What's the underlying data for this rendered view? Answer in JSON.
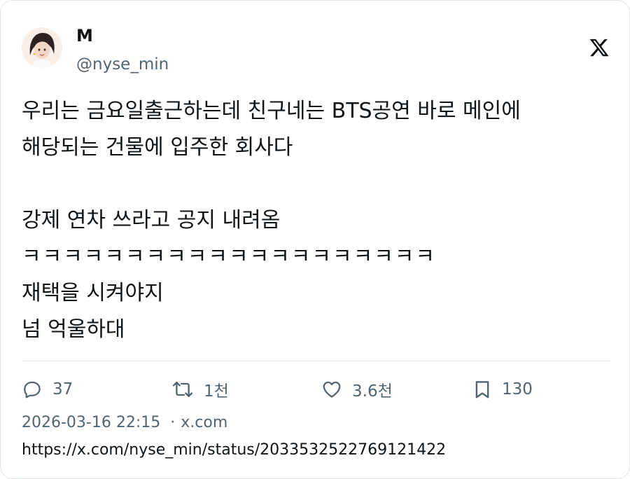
{
  "author": {
    "name": "M",
    "handle": "@nyse_min"
  },
  "tweet": {
    "lines": [
      "우리는 금요일출근하는데 친구네는 BTS공연 바로 메인에",
      "해당되는 건물에 입주한 회사다",
      "",
      "강제 연차 쓰라고 공지 내려옴",
      "ㅋㅋㅋㅋㅋㅋㅋㅋㅋㅋㅋㅋㅋㅋㅋㅋㅋㅋㅋㅋ",
      "재택을 시켜야지",
      "넘 억울하대"
    ]
  },
  "actions": {
    "replies": "37",
    "retweets": "1천",
    "likes": "3.6천",
    "bookmarks": "130"
  },
  "meta": {
    "timestamp": "2026-03-16 22:15",
    "source": "x.com",
    "url": "https://x.com/nyse_min/status/2033532522769121422"
  },
  "icons": {
    "logo": "x-logo-icon",
    "reply": "reply-icon",
    "retweet": "retweet-icon",
    "like": "heart-icon",
    "bookmark": "bookmark-icon"
  },
  "colors": {
    "text": "#0f1419",
    "muted": "#536471",
    "divider": "#e6e9ec"
  }
}
